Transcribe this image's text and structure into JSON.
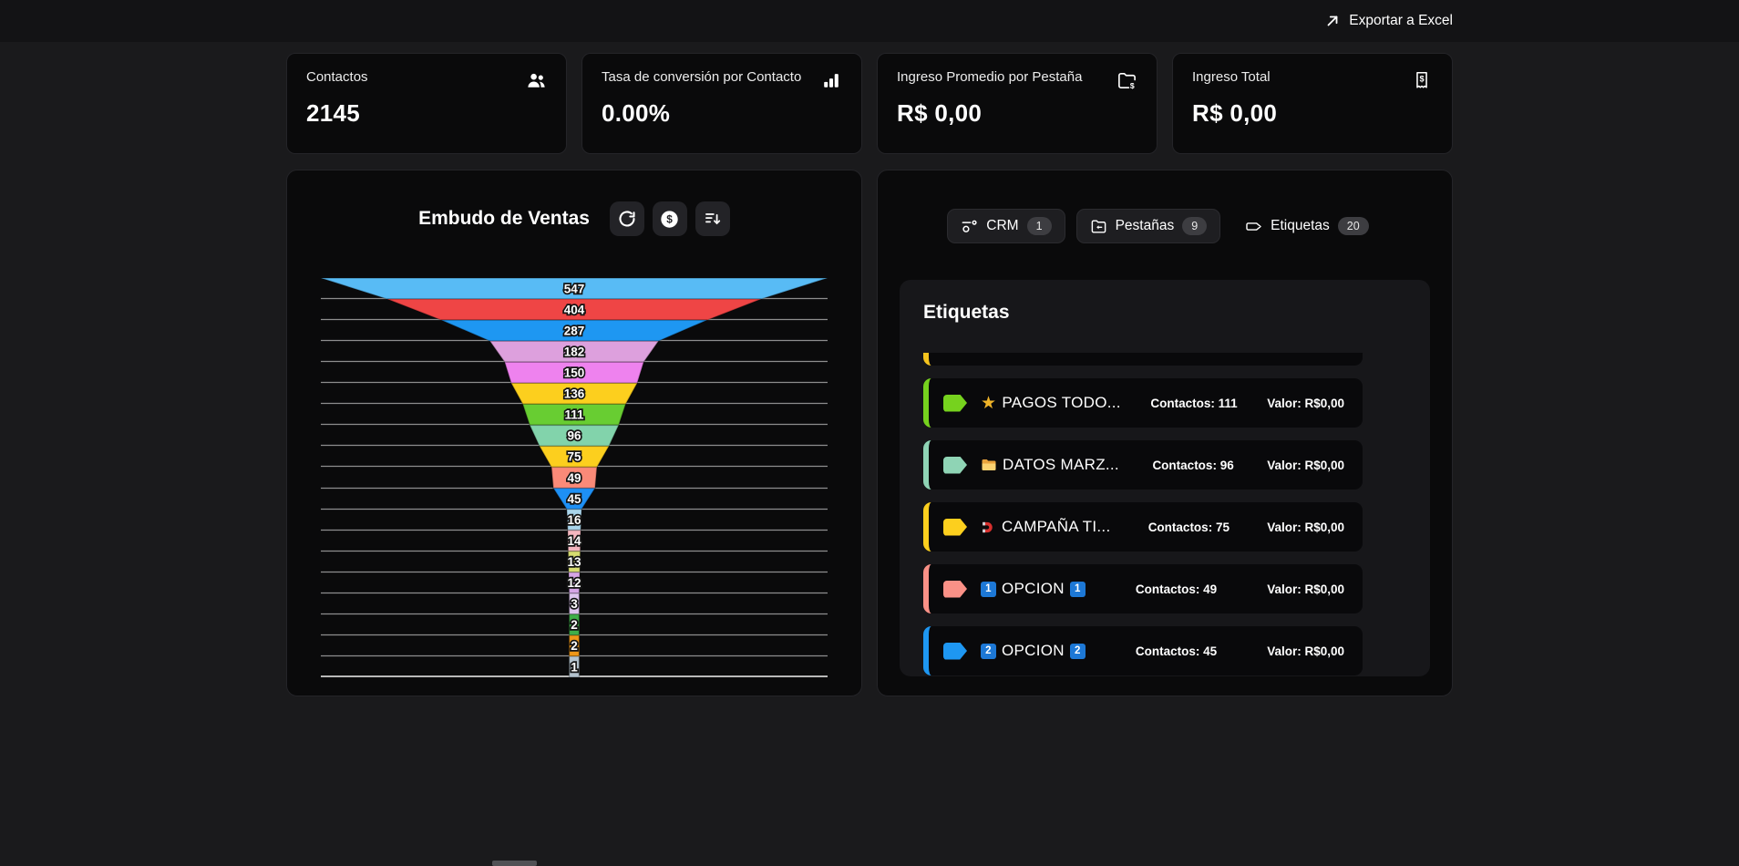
{
  "topbar": {
    "export_label": "Exportar a Excel",
    "export_icon": "arrow-up-right-icon"
  },
  "stats": [
    {
      "label": "Contactos",
      "value": "2145",
      "icon": "people-icon"
    },
    {
      "label": "Tasa de conversión por Contacto",
      "value": "0.00%",
      "icon": "bar-chart-icon"
    },
    {
      "label": "Ingreso Promedio por Pestaña",
      "value": "R$ 0,00",
      "icon": "folder-dollar-icon"
    },
    {
      "label": "Ingreso Total",
      "value": "R$ 0,00",
      "icon": "receipt-dollar-icon"
    }
  ],
  "funnel_panel": {
    "title": "Embudo de Ventas",
    "tools": [
      {
        "icon": "refresh-icon"
      },
      {
        "icon": "dollar-coin-icon"
      },
      {
        "icon": "sort-descending-icon"
      }
    ]
  },
  "chart_data": {
    "type": "funnel",
    "title": "Embudo de Ventas",
    "values": [
      547,
      404,
      287,
      182,
      150,
      136,
      111,
      96,
      75,
      49,
      45,
      16,
      14,
      13,
      12,
      3,
      2,
      2,
      1
    ],
    "labels": [
      "547",
      "404",
      "287",
      "182",
      "150",
      "136",
      "111",
      "96",
      "75",
      "49",
      "45",
      "16",
      "14",
      "13",
      "12",
      "3",
      "2",
      "2",
      "1"
    ],
    "colors": [
      "#58bbf5",
      "#ef4545",
      "#1e97f2",
      "#dda0dd",
      "#ee82ee",
      "#fccf1e",
      "#68cd32",
      "#82d3ab",
      "#fccf1e",
      "#fa8a78",
      "#1e90f5",
      "#a9d5ec",
      "#f4b6bf",
      "#d6dc70",
      "#d5a5e6",
      "#ddc5ee",
      "#3fae49",
      "#ee9718",
      "#b3c2cd"
    ],
    "grid": true,
    "label_style": "white text with dark outline, centered per segment"
  },
  "right_panel": {
    "tabs": [
      {
        "label": "CRM",
        "badge": "1",
        "icon": "crm-icon",
        "active": false
      },
      {
        "label": "Pestañas",
        "badge": "9",
        "icon": "folder-tab-icon",
        "active": false
      },
      {
        "label": "Etiquetas",
        "badge": "20",
        "icon": "tag-icon",
        "active": true
      }
    ],
    "card_title": "Etiquetas",
    "items": [
      {
        "partial": true,
        "color": "#f5c41e",
        "icon_left": null,
        "icon_right": null,
        "label": "",
        "contacts": "",
        "value": ""
      },
      {
        "partial": false,
        "color": "#76d21e",
        "icon_left": "star",
        "icon_right": null,
        "label": "PAGOS TODO...",
        "contacts": "Contactos: 111",
        "value": "Valor: R$0,00"
      },
      {
        "partial": false,
        "color": "#8fd4b5",
        "icon_left": "folder",
        "icon_right": null,
        "label": "DATOS MARZ...",
        "contacts": "Contactos: 96",
        "value": "Valor: R$0,00"
      },
      {
        "partial": false,
        "color": "#fccf1e",
        "icon_left": "magnet",
        "icon_right": null,
        "label": "CAMPAÑA TI...",
        "contacts": "Contactos: 75",
        "value": "Valor: R$0,00"
      },
      {
        "partial": false,
        "color": "#fa9187",
        "icon_left": "keycap-1",
        "icon_right": "keycap-1",
        "label": "OPCION",
        "contacts": "Contactos: 49",
        "value": "Valor: R$0,00"
      },
      {
        "partial": false,
        "color": "#1e97f2",
        "icon_left": "keycap-2",
        "icon_right": "keycap-2",
        "label": "OPCION",
        "contacts": "Contactos: 45",
        "value": "Valor: R$0,00"
      }
    ]
  }
}
